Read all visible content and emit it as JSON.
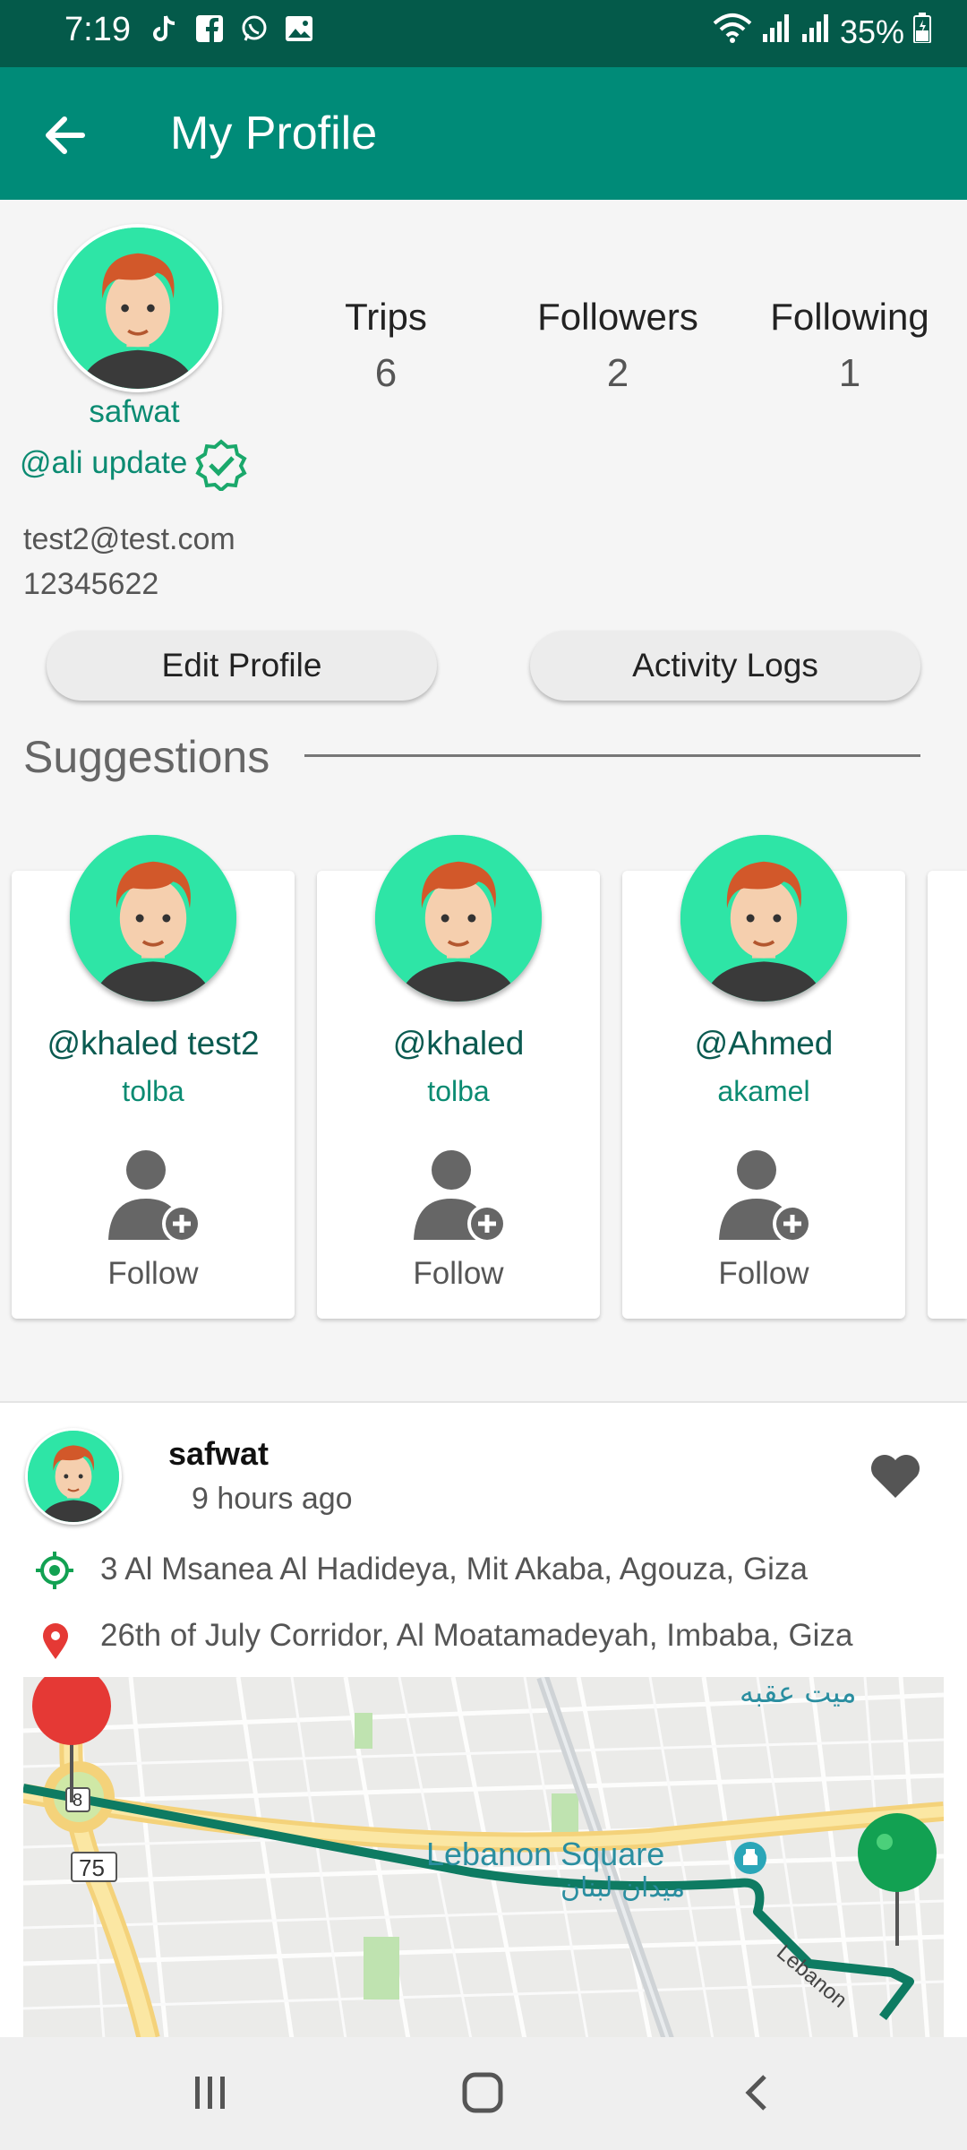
{
  "status_bar": {
    "time": "7:19",
    "battery": "35%",
    "icons": [
      "tiktok-icon",
      "facebook-icon",
      "whatsapp-icon",
      "gallery-icon",
      "wifi-icon",
      "signal-icon",
      "signal-icon",
      "battery-charging-icon"
    ]
  },
  "app_bar": {
    "title": "My Profile",
    "back_icon": "arrow-back-icon"
  },
  "profile": {
    "name": "safwat",
    "handle": "@ali update",
    "email": "test2@test.com",
    "phone": "12345622",
    "stats": [
      {
        "label": "Trips",
        "value": "6"
      },
      {
        "label": "Followers",
        "value": "2"
      },
      {
        "label": "Following",
        "value": "1"
      }
    ],
    "edit_button": "Edit Profile",
    "activity_button": "Activity Logs"
  },
  "suggestions": {
    "title": "Suggestions",
    "items": [
      {
        "username": "@khaled test2",
        "name": "tolba",
        "action": "Follow"
      },
      {
        "username": "@khaled",
        "name": "tolba",
        "action": "Follow"
      },
      {
        "username": "@Ahmed",
        "name": "akamel",
        "action": "Follow"
      }
    ]
  },
  "post": {
    "author": "safwat",
    "time": "9 hours ago",
    "from": "3 Al Msanea Al Hadideya, Mit Akaba, Agouza, Giza",
    "to": "26th of July Corridor, Al Moatamadeyah, Imbaba, Giza",
    "map": {
      "label_en": "Lebanon Square",
      "label_ar": "ميدان لبنان",
      "label_ar_top": "ميت عقبه",
      "road_number": "75",
      "road_small": "8",
      "street": "Lebanon"
    }
  },
  "colors": {
    "status_bar": "#045a4a",
    "app_bar": "#008b78",
    "accent": "#0b8b72",
    "route": "#0e7b62",
    "start_pin": "#12a152",
    "end_pin": "#e53935"
  }
}
